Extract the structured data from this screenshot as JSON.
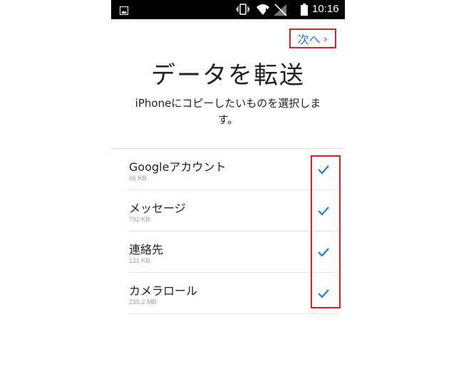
{
  "status_bar": {
    "time": "10:16",
    "icons": [
      "gallery-icon",
      "vibrate-icon",
      "wifi-icon",
      "signal-icon",
      "battery-icon"
    ]
  },
  "header": {
    "next_label": "次へ",
    "next_chevron": "›"
  },
  "title": "データを転送",
  "subtitle": "iPhoneにコピーしたいものを選択します。",
  "items": [
    {
      "name": "Googleアカウント",
      "size": "66 KB",
      "checked": true
    },
    {
      "name": "メッセージ",
      "size": "792 KB",
      "checked": true
    },
    {
      "name": "連絡先",
      "size": "121 KB",
      "checked": true
    },
    {
      "name": "カメラロール",
      "size": "235.2 MB",
      "checked": true
    }
  ],
  "colors": {
    "accent": "#1e7ce8",
    "highlight": "#e02020",
    "text": "#222222",
    "secondary_text": "#9a9a9a"
  }
}
